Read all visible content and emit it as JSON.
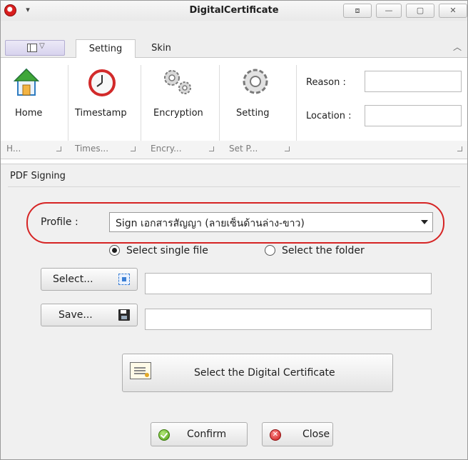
{
  "window": {
    "title": "DigitalCertificate"
  },
  "tabs": [
    {
      "label": "Setting",
      "active": true
    },
    {
      "label": "Skin",
      "active": false
    }
  ],
  "ribbon": {
    "buttons": [
      {
        "label": "Home",
        "icon": "home-icon"
      },
      {
        "label": "Timestamp",
        "icon": "clock-icon"
      },
      {
        "label": "Encryption",
        "icon": "gears-icon"
      },
      {
        "label": "Setting",
        "icon": "gear-icon"
      }
    ],
    "groups": [
      "H...",
      "Times...",
      "Encry...",
      "Set P..."
    ],
    "fields": [
      {
        "label": "Reason :",
        "value": ""
      },
      {
        "label": "Location :",
        "value": ""
      }
    ]
  },
  "panel": {
    "title": "PDF Signing",
    "profile_label": "Profile :",
    "profile_value": "Sign เอกสารสัญญา (ลายเซ็นด้านล่าง-ขาว)",
    "radio_single": "Select single file",
    "radio_folder": "Select the folder",
    "select_button": "Select...",
    "save_button": "Save...",
    "select_path": "",
    "save_path": "",
    "cert_button": "Select the Digital Certificate",
    "confirm_button": "Confirm",
    "close_button": "Close"
  },
  "colors": {
    "highlight": "#d62424",
    "accent": "#d91e1e"
  }
}
